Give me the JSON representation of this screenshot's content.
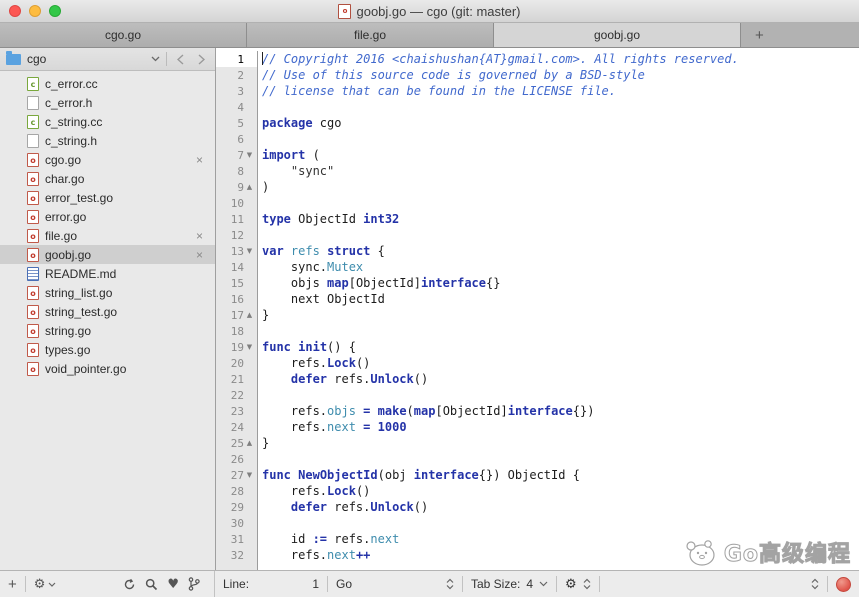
{
  "window": {
    "title": "goobj.go — cgo (git: master)"
  },
  "tabbar": {
    "tabs": [
      {
        "label": "cgo.go",
        "active": false
      },
      {
        "label": "file.go",
        "active": false
      },
      {
        "label": "goobj.go",
        "active": true
      }
    ],
    "new_tab_label": "+"
  },
  "sidebar": {
    "folder": "cgo",
    "close_glyph": "×",
    "files": [
      {
        "name": "c_error.cc",
        "icon": "cc"
      },
      {
        "name": "c_error.h",
        "icon": "h"
      },
      {
        "name": "c_string.cc",
        "icon": "cc"
      },
      {
        "name": "c_string.h",
        "icon": "h"
      },
      {
        "name": "cgo.go",
        "icon": "go",
        "closable": true
      },
      {
        "name": "char.go",
        "icon": "go"
      },
      {
        "name": "error_test.go",
        "icon": "go"
      },
      {
        "name": "error.go",
        "icon": "go"
      },
      {
        "name": "file.go",
        "icon": "go",
        "closable": true
      },
      {
        "name": "goobj.go",
        "icon": "go",
        "closable": true,
        "selected": true
      },
      {
        "name": "README.md",
        "icon": "md"
      },
      {
        "name": "string_list.go",
        "icon": "go"
      },
      {
        "name": "string_test.go",
        "icon": "go"
      },
      {
        "name": "string.go",
        "icon": "go"
      },
      {
        "name": "types.go",
        "icon": "go"
      },
      {
        "name": "void_pointer.go",
        "icon": "go"
      }
    ]
  },
  "editor": {
    "current_line": 1,
    "fold_down_glyph": "▼",
    "fold_up_glyph": "▲",
    "lines": [
      {
        "n": 1,
        "tokens": [
          [
            "cm",
            "// Copyright 2016 <chaishushan{AT}gmail.com>. All rights reserved."
          ]
        ]
      },
      {
        "n": 2,
        "tokens": [
          [
            "cm",
            "// Use of this source code is governed by a BSD-style"
          ]
        ]
      },
      {
        "n": 3,
        "tokens": [
          [
            "cm",
            "// license that can be found in the LICENSE file."
          ]
        ]
      },
      {
        "n": 4,
        "tokens": []
      },
      {
        "n": 5,
        "tokens": [
          [
            "kw",
            "package"
          ],
          [
            "pl",
            " cgo"
          ]
        ]
      },
      {
        "n": 6,
        "tokens": []
      },
      {
        "n": 7,
        "fold": "down",
        "tokens": [
          [
            "kw",
            "import"
          ],
          [
            "pl",
            " ("
          ]
        ]
      },
      {
        "n": 8,
        "tokens": [
          [
            "st",
            "    \"sync\""
          ]
        ]
      },
      {
        "n": 9,
        "fold": "up",
        "tokens": [
          [
            "pl",
            ")"
          ]
        ]
      },
      {
        "n": 10,
        "tokens": []
      },
      {
        "n": 11,
        "tokens": [
          [
            "kw",
            "type"
          ],
          [
            "pl",
            " ObjectId "
          ],
          [
            "kw",
            "int32"
          ]
        ]
      },
      {
        "n": 12,
        "tokens": []
      },
      {
        "n": 13,
        "fold": "down",
        "tokens": [
          [
            "kw",
            "var"
          ],
          [
            "pl",
            " "
          ],
          [
            "pr",
            "refs"
          ],
          [
            "pl",
            " "
          ],
          [
            "kw",
            "struct"
          ],
          [
            "pl",
            " {"
          ]
        ]
      },
      {
        "n": 14,
        "tokens": [
          [
            "pl",
            "    sync."
          ],
          [
            "pr",
            "Mutex"
          ]
        ]
      },
      {
        "n": 15,
        "tokens": [
          [
            "pl",
            "    objs "
          ],
          [
            "kw",
            "map"
          ],
          [
            "pl",
            "[ObjectId]"
          ],
          [
            "kw",
            "interface"
          ],
          [
            "pl",
            "{}"
          ]
        ]
      },
      {
        "n": 16,
        "tokens": [
          [
            "pl",
            "    next ObjectId"
          ]
        ]
      },
      {
        "n": 17,
        "fold": "up",
        "tokens": [
          [
            "pl",
            "}"
          ]
        ]
      },
      {
        "n": 18,
        "tokens": []
      },
      {
        "n": 19,
        "fold": "down",
        "tokens": [
          [
            "kw",
            "func"
          ],
          [
            "pl",
            " "
          ],
          [
            "fn",
            "init"
          ],
          [
            "pl",
            "() {"
          ]
        ]
      },
      {
        "n": 20,
        "tokens": [
          [
            "pl",
            "    refs."
          ],
          [
            "fn",
            "Lock"
          ],
          [
            "pl",
            "()"
          ]
        ]
      },
      {
        "n": 21,
        "tokens": [
          [
            "pl",
            "    "
          ],
          [
            "kw",
            "defer"
          ],
          [
            "pl",
            " refs."
          ],
          [
            "fn",
            "Unlock"
          ],
          [
            "pl",
            "()"
          ]
        ]
      },
      {
        "n": 22,
        "tokens": []
      },
      {
        "n": 23,
        "tokens": [
          [
            "pl",
            "    refs."
          ],
          [
            "pr",
            "objs"
          ],
          [
            "pl",
            " "
          ],
          [
            "kw",
            "="
          ],
          [
            "pl",
            " "
          ],
          [
            "fn",
            "make"
          ],
          [
            "pl",
            "("
          ],
          [
            "kw",
            "map"
          ],
          [
            "pl",
            "[ObjectId]"
          ],
          [
            "kw",
            "interface"
          ],
          [
            "pl",
            "{})"
          ]
        ]
      },
      {
        "n": 24,
        "tokens": [
          [
            "pl",
            "    refs."
          ],
          [
            "pr",
            "next"
          ],
          [
            "pl",
            " "
          ],
          [
            "kw",
            "="
          ],
          [
            "pl",
            " "
          ],
          [
            "num",
            "1000"
          ]
        ]
      },
      {
        "n": 25,
        "fold": "up",
        "tokens": [
          [
            "pl",
            "}"
          ]
        ]
      },
      {
        "n": 26,
        "tokens": []
      },
      {
        "n": 27,
        "fold": "down",
        "tokens": [
          [
            "kw",
            "func"
          ],
          [
            "pl",
            " "
          ],
          [
            "fn",
            "NewObjectId"
          ],
          [
            "pl",
            "(obj "
          ],
          [
            "kw",
            "interface"
          ],
          [
            "pl",
            "{}) ObjectId {"
          ]
        ]
      },
      {
        "n": 28,
        "tokens": [
          [
            "pl",
            "    refs."
          ],
          [
            "fn",
            "Lock"
          ],
          [
            "pl",
            "()"
          ]
        ]
      },
      {
        "n": 29,
        "tokens": [
          [
            "pl",
            "    "
          ],
          [
            "kw",
            "defer"
          ],
          [
            "pl",
            " refs."
          ],
          [
            "fn",
            "Unlock"
          ],
          [
            "pl",
            "()"
          ]
        ]
      },
      {
        "n": 30,
        "tokens": []
      },
      {
        "n": 31,
        "tokens": [
          [
            "pl",
            "    id "
          ],
          [
            "kw",
            ":="
          ],
          [
            "pl",
            " refs."
          ],
          [
            "pr",
            "next"
          ]
        ]
      },
      {
        "n": 32,
        "tokens": [
          [
            "pl",
            "    refs."
          ],
          [
            "pr",
            "next"
          ],
          [
            "kw",
            "++"
          ]
        ]
      }
    ]
  },
  "statusbar": {
    "add_label": "+",
    "line_label": "Line:",
    "line_value": "1",
    "language": "Go",
    "tab_size_label": "Tab Size:",
    "tab_size_value": "4"
  },
  "watermark": {
    "text": "Go高级编程"
  },
  "colors": {
    "keyword": "#2433a8",
    "comment": "#4169cd",
    "property": "#3e8cad",
    "string": "#333333",
    "selected_row": "#cfcfcf",
    "record_button": "#e0564c",
    "folder_icon": "#5aa2e0"
  }
}
